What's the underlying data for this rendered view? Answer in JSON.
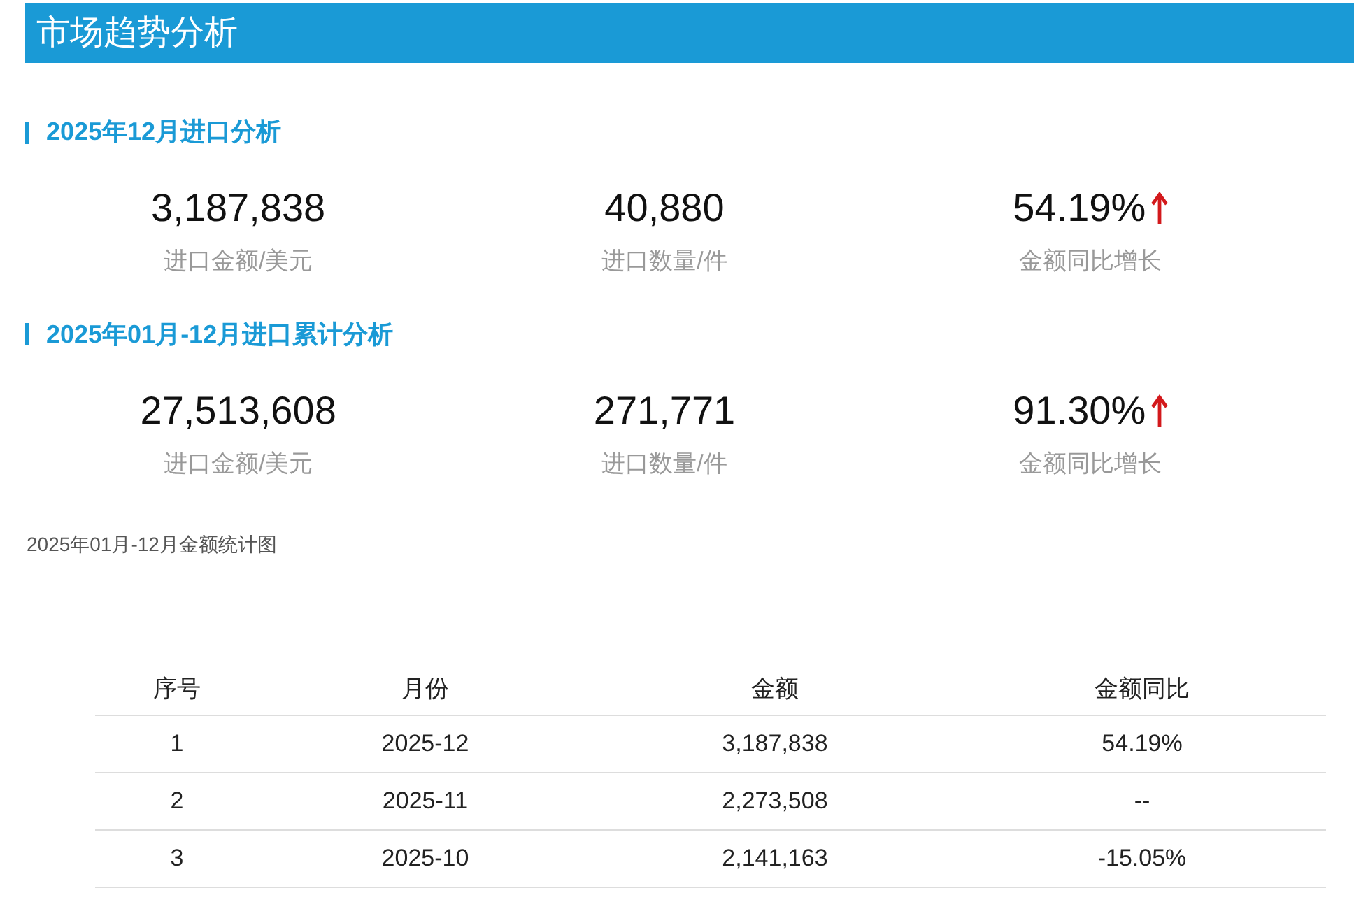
{
  "header": {
    "title": "市场趋势分析"
  },
  "sections": [
    {
      "title": "2025年12月进口分析",
      "stats": [
        {
          "value": "3,187,838",
          "label": "进口金额/美元",
          "kind": "plain"
        },
        {
          "value": "40,880",
          "label": "进口数量/件",
          "kind": "plain"
        },
        {
          "value": "54.19%",
          "label": "金额同比增长",
          "kind": "rising"
        }
      ]
    },
    {
      "title": "2025年01月-12月进口累计分析",
      "stats": [
        {
          "value": "27,513,608",
          "label": "进口金额/美元",
          "kind": "plain"
        },
        {
          "value": "271,771",
          "label": "进口数量/件",
          "kind": "plain"
        },
        {
          "value": "91.30%",
          "label": "金额同比增长",
          "kind": "rising"
        }
      ]
    }
  ],
  "chart_caption": "2025年01月-12月金额统计图",
  "table": {
    "columns": [
      "序号",
      "月份",
      "金额",
      "金额同比"
    ],
    "rows": [
      [
        "1",
        "2025-12",
        "3,187,838",
        "54.19%"
      ],
      [
        "2",
        "2025-11",
        "2,273,508",
        "--"
      ],
      [
        "3",
        "2025-10",
        "2,141,163",
        "-15.05%"
      ]
    ]
  }
}
